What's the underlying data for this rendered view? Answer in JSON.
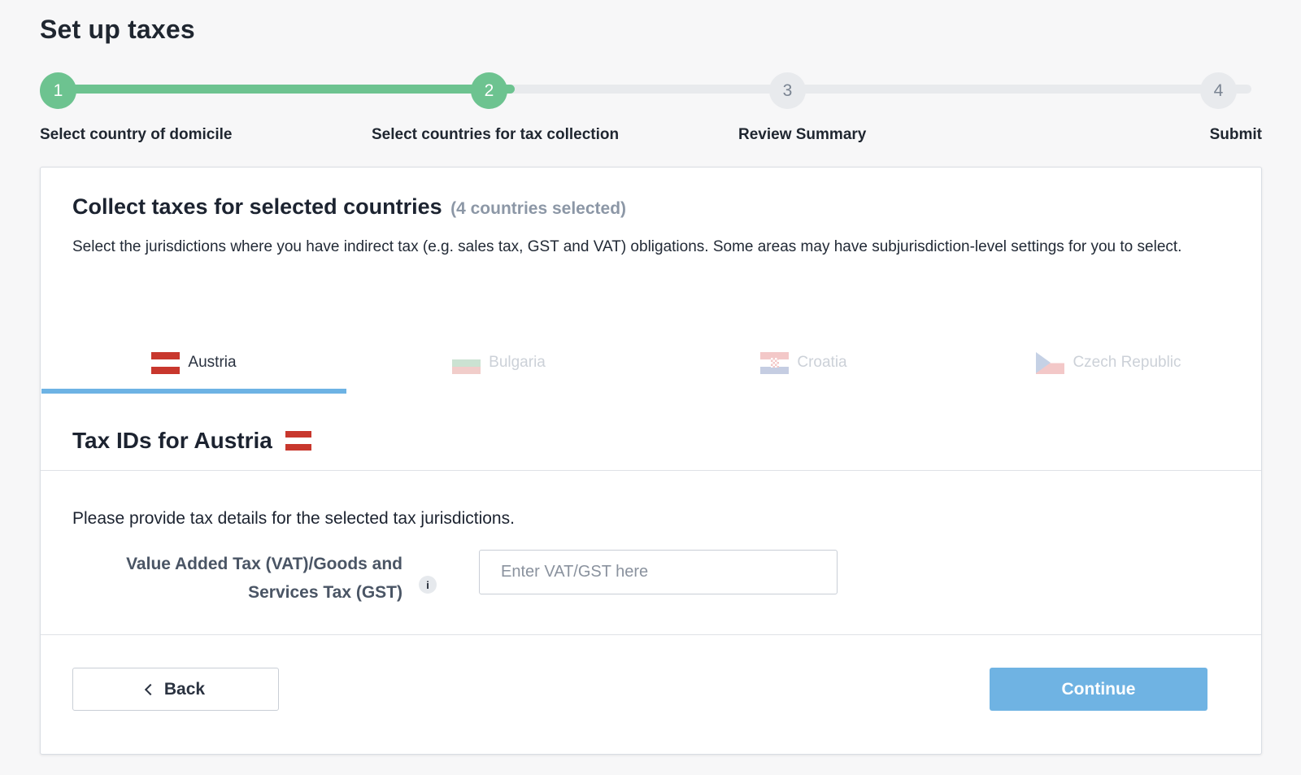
{
  "page": {
    "title": "Set up taxes"
  },
  "stepper": {
    "steps": [
      {
        "number": "1",
        "label": "Select country of domicile",
        "state": "done"
      },
      {
        "number": "2",
        "label": "Select countries for tax collection",
        "state": "current"
      },
      {
        "number": "3",
        "label": "Review Summary",
        "state": "todo"
      },
      {
        "number": "4",
        "label": "Submit",
        "state": "todo"
      }
    ]
  },
  "card": {
    "title": "Collect taxes for selected countries",
    "count": "(4 countries selected)",
    "description": "Select the jurisdictions where you have indirect tax (e.g. sales tax, GST and VAT) obligations. Some areas may have subjurisdiction-level settings for you to select."
  },
  "tabs": [
    {
      "label": "Austria",
      "flag": "flag-austria-icon",
      "active": true
    },
    {
      "label": "Bulgaria",
      "flag": "flag-bulgaria-icon",
      "active": false
    },
    {
      "label": "Croatia",
      "flag": "flag-croatia-icon",
      "active": false
    },
    {
      "label": "Czech Republic",
      "flag": "flag-czech-republic-icon",
      "active": false
    }
  ],
  "tax_section": {
    "title": "Tax IDs for Austria",
    "intro": "Please provide tax details for the selected tax jurisdictions.",
    "field_label_line1": "Value Added Tax (VAT)/Goods and",
    "field_label_line2": "Services Tax (GST)",
    "info_icon": "i",
    "input_value": "",
    "input_placeholder": "Enter VAT/GST here"
  },
  "actions": {
    "back_label": "Back",
    "continue_label": "Continue"
  },
  "colors": {
    "progress_done": "#6dc390",
    "progress_todo": "#e8eaed",
    "accent": "#6db3e4",
    "continue_button": "#6fb3e3"
  }
}
